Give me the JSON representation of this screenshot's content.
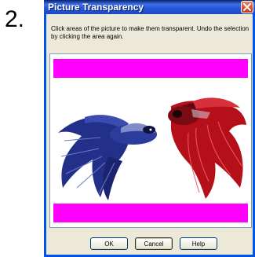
{
  "step_number": "2.",
  "dialog": {
    "title": "Picture Transparency",
    "instructions": "Click areas of the picture to make them transparent. Undo the selection by clicking the area again.",
    "buttons": {
      "ok": "OK",
      "cancel": "Cancel",
      "help": "Help"
    }
  },
  "colors": {
    "title_bar": "#2457d8",
    "dialog_background": "#ece9d8",
    "transparent_key": "#ff00ff",
    "fish_blue": "#2a3a96",
    "fish_red": "#c4101c"
  },
  "icons": [
    "close-icon"
  ]
}
